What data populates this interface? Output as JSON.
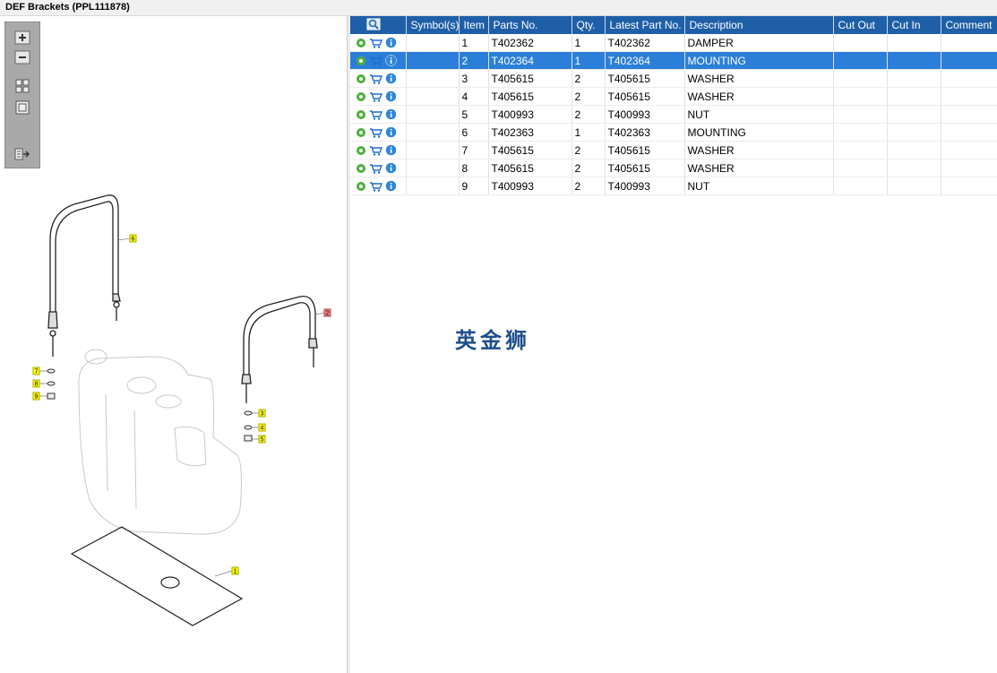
{
  "window": {
    "title": "DEF Brackets (PPL111878)"
  },
  "toolbar": {
    "zoom_in": "zoom-in",
    "zoom_out": "zoom-out",
    "fit_all": "fit-all",
    "fit_window": "fit-window",
    "export": "export"
  },
  "table": {
    "headers": [
      "",
      "Symbol(s)",
      "Item",
      "Parts No.",
      "Qty.",
      "Latest Part No.",
      "Description",
      "Cut Out",
      "Cut In",
      "Comment"
    ],
    "rows": [
      {
        "item": "1",
        "part": "T402362",
        "qty": "1",
        "latest": "T402362",
        "desc": "DAMPER",
        "selected": false
      },
      {
        "item": "2",
        "part": "T402364",
        "qty": "1",
        "latest": "T402364",
        "desc": "MOUNTING",
        "selected": true
      },
      {
        "item": "3",
        "part": "T405615",
        "qty": "2",
        "latest": "T405615",
        "desc": "WASHER",
        "selected": false
      },
      {
        "item": "4",
        "part": "T405615",
        "qty": "2",
        "latest": "T405615",
        "desc": "WASHER",
        "selected": false
      },
      {
        "item": "5",
        "part": "T400993",
        "qty": "2",
        "latest": "T400993",
        "desc": "NUT",
        "selected": false
      },
      {
        "item": "6",
        "part": "T402363",
        "qty": "1",
        "latest": "T402363",
        "desc": "MOUNTING",
        "selected": false
      },
      {
        "item": "7",
        "part": "T405615",
        "qty": "2",
        "latest": "T405615",
        "desc": "WASHER",
        "selected": false
      },
      {
        "item": "8",
        "part": "T405615",
        "qty": "2",
        "latest": "T405615",
        "desc": "WASHER",
        "selected": false
      },
      {
        "item": "9",
        "part": "T400993",
        "qty": "2",
        "latest": "T400993",
        "desc": "NUT",
        "selected": false
      }
    ]
  },
  "callouts": [
    "6",
    "2",
    "7",
    "8",
    "9",
    "3",
    "4",
    "5",
    "1"
  ],
  "watermark": "英金狮",
  "colors": {
    "header_bg": "#1e5fa8",
    "selected_bg": "#2b7fd8",
    "callout_yellow": "#ffff00",
    "callout_selected": "#f08080"
  }
}
